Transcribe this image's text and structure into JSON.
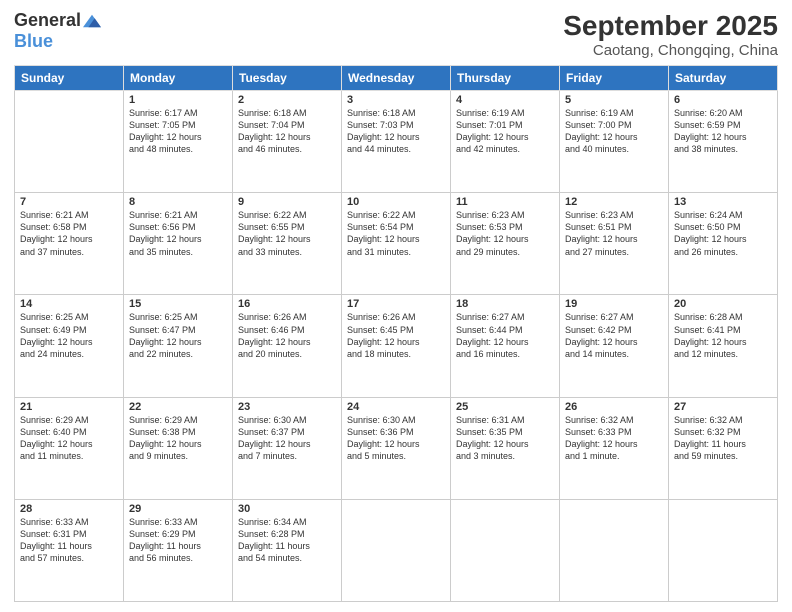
{
  "logo": {
    "general": "General",
    "blue": "Blue"
  },
  "header": {
    "month": "September 2025",
    "location": "Caotang, Chongqing, China"
  },
  "weekdays": [
    "Sunday",
    "Monday",
    "Tuesday",
    "Wednesday",
    "Thursday",
    "Friday",
    "Saturday"
  ],
  "weeks": [
    [
      {
        "day": "",
        "info": ""
      },
      {
        "day": "1",
        "info": "Sunrise: 6:17 AM\nSunset: 7:05 PM\nDaylight: 12 hours\nand 48 minutes."
      },
      {
        "day": "2",
        "info": "Sunrise: 6:18 AM\nSunset: 7:04 PM\nDaylight: 12 hours\nand 46 minutes."
      },
      {
        "day": "3",
        "info": "Sunrise: 6:18 AM\nSunset: 7:03 PM\nDaylight: 12 hours\nand 44 minutes."
      },
      {
        "day": "4",
        "info": "Sunrise: 6:19 AM\nSunset: 7:01 PM\nDaylight: 12 hours\nand 42 minutes."
      },
      {
        "day": "5",
        "info": "Sunrise: 6:19 AM\nSunset: 7:00 PM\nDaylight: 12 hours\nand 40 minutes."
      },
      {
        "day": "6",
        "info": "Sunrise: 6:20 AM\nSunset: 6:59 PM\nDaylight: 12 hours\nand 38 minutes."
      }
    ],
    [
      {
        "day": "7",
        "info": "Sunrise: 6:21 AM\nSunset: 6:58 PM\nDaylight: 12 hours\nand 37 minutes."
      },
      {
        "day": "8",
        "info": "Sunrise: 6:21 AM\nSunset: 6:56 PM\nDaylight: 12 hours\nand 35 minutes."
      },
      {
        "day": "9",
        "info": "Sunrise: 6:22 AM\nSunset: 6:55 PM\nDaylight: 12 hours\nand 33 minutes."
      },
      {
        "day": "10",
        "info": "Sunrise: 6:22 AM\nSunset: 6:54 PM\nDaylight: 12 hours\nand 31 minutes."
      },
      {
        "day": "11",
        "info": "Sunrise: 6:23 AM\nSunset: 6:53 PM\nDaylight: 12 hours\nand 29 minutes."
      },
      {
        "day": "12",
        "info": "Sunrise: 6:23 AM\nSunset: 6:51 PM\nDaylight: 12 hours\nand 27 minutes."
      },
      {
        "day": "13",
        "info": "Sunrise: 6:24 AM\nSunset: 6:50 PM\nDaylight: 12 hours\nand 26 minutes."
      }
    ],
    [
      {
        "day": "14",
        "info": "Sunrise: 6:25 AM\nSunset: 6:49 PM\nDaylight: 12 hours\nand 24 minutes."
      },
      {
        "day": "15",
        "info": "Sunrise: 6:25 AM\nSunset: 6:47 PM\nDaylight: 12 hours\nand 22 minutes."
      },
      {
        "day": "16",
        "info": "Sunrise: 6:26 AM\nSunset: 6:46 PM\nDaylight: 12 hours\nand 20 minutes."
      },
      {
        "day": "17",
        "info": "Sunrise: 6:26 AM\nSunset: 6:45 PM\nDaylight: 12 hours\nand 18 minutes."
      },
      {
        "day": "18",
        "info": "Sunrise: 6:27 AM\nSunset: 6:44 PM\nDaylight: 12 hours\nand 16 minutes."
      },
      {
        "day": "19",
        "info": "Sunrise: 6:27 AM\nSunset: 6:42 PM\nDaylight: 12 hours\nand 14 minutes."
      },
      {
        "day": "20",
        "info": "Sunrise: 6:28 AM\nSunset: 6:41 PM\nDaylight: 12 hours\nand 12 minutes."
      }
    ],
    [
      {
        "day": "21",
        "info": "Sunrise: 6:29 AM\nSunset: 6:40 PM\nDaylight: 12 hours\nand 11 minutes."
      },
      {
        "day": "22",
        "info": "Sunrise: 6:29 AM\nSunset: 6:38 PM\nDaylight: 12 hours\nand 9 minutes."
      },
      {
        "day": "23",
        "info": "Sunrise: 6:30 AM\nSunset: 6:37 PM\nDaylight: 12 hours\nand 7 minutes."
      },
      {
        "day": "24",
        "info": "Sunrise: 6:30 AM\nSunset: 6:36 PM\nDaylight: 12 hours\nand 5 minutes."
      },
      {
        "day": "25",
        "info": "Sunrise: 6:31 AM\nSunset: 6:35 PM\nDaylight: 12 hours\nand 3 minutes."
      },
      {
        "day": "26",
        "info": "Sunrise: 6:32 AM\nSunset: 6:33 PM\nDaylight: 12 hours\nand 1 minute."
      },
      {
        "day": "27",
        "info": "Sunrise: 6:32 AM\nSunset: 6:32 PM\nDaylight: 11 hours\nand 59 minutes."
      }
    ],
    [
      {
        "day": "28",
        "info": "Sunrise: 6:33 AM\nSunset: 6:31 PM\nDaylight: 11 hours\nand 57 minutes."
      },
      {
        "day": "29",
        "info": "Sunrise: 6:33 AM\nSunset: 6:29 PM\nDaylight: 11 hours\nand 56 minutes."
      },
      {
        "day": "30",
        "info": "Sunrise: 6:34 AM\nSunset: 6:28 PM\nDaylight: 11 hours\nand 54 minutes."
      },
      {
        "day": "",
        "info": ""
      },
      {
        "day": "",
        "info": ""
      },
      {
        "day": "",
        "info": ""
      },
      {
        "day": "",
        "info": ""
      }
    ]
  ]
}
